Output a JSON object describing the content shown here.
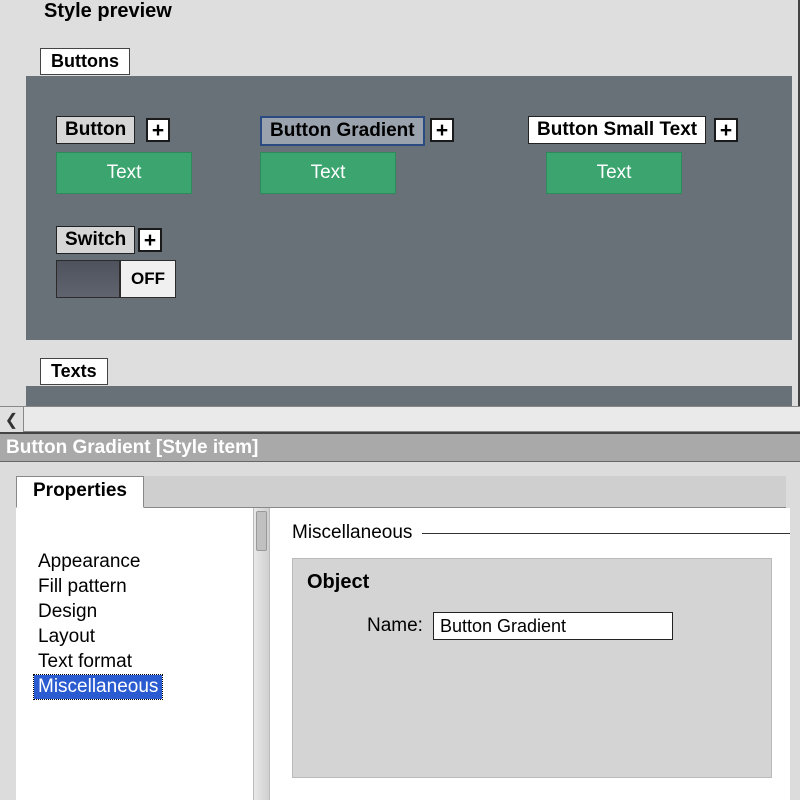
{
  "preview": {
    "title": "Style preview",
    "groups": {
      "buttons_label": "Buttons",
      "texts_label": "Texts"
    },
    "items": {
      "button": {
        "label": "Button",
        "sample_text": "Text"
      },
      "button_gradient": {
        "label": "Button Gradient",
        "sample_text": "Text"
      },
      "button_small_text": {
        "label": "Button Small Text",
        "sample_text": "Text"
      },
      "switch": {
        "label": "Switch",
        "state_text": "OFF"
      }
    },
    "plus": "+"
  },
  "header": {
    "title": "Button Gradient [Style item]"
  },
  "properties": {
    "tab_label": "Properties",
    "categories": [
      "Appearance",
      "Fill pattern",
      "Design",
      "Layout",
      "Text format",
      "Miscellaneous"
    ],
    "selected_category_index": 5,
    "section_title": "Miscellaneous",
    "object": {
      "group_title": "Object",
      "name_label": "Name:",
      "name_value": "Button Gradient"
    }
  }
}
